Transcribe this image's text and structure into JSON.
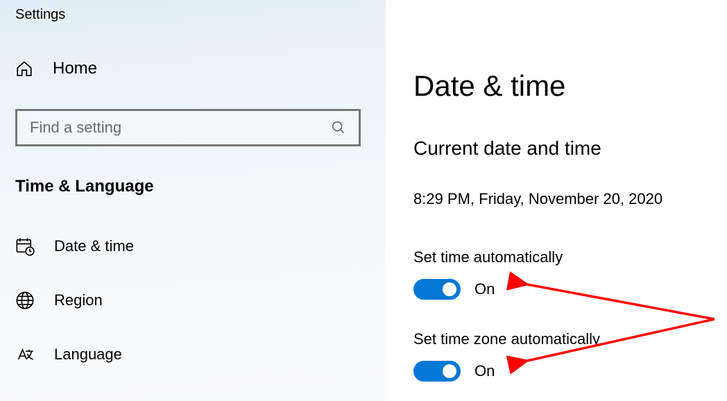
{
  "window": {
    "title": "Settings"
  },
  "sidebar": {
    "home_label": "Home",
    "search_placeholder": "Find a setting",
    "category_title": "Time & Language",
    "items": [
      {
        "label": "Date & time",
        "icon": "calendar-clock-icon"
      },
      {
        "label": "Region",
        "icon": "globe-icon"
      },
      {
        "label": "Language",
        "icon": "language-icon"
      }
    ]
  },
  "main": {
    "title": "Date & time",
    "section_heading": "Current date and time",
    "current_value": "8:29 PM, Friday, November 20, 2020",
    "toggles": [
      {
        "label": "Set time automatically",
        "state": "On",
        "value": true
      },
      {
        "label": "Set time zone automatically",
        "state": "On",
        "value": true
      }
    ]
  },
  "colors": {
    "accent": "#0078d4",
    "annotation": "#ff0000"
  }
}
